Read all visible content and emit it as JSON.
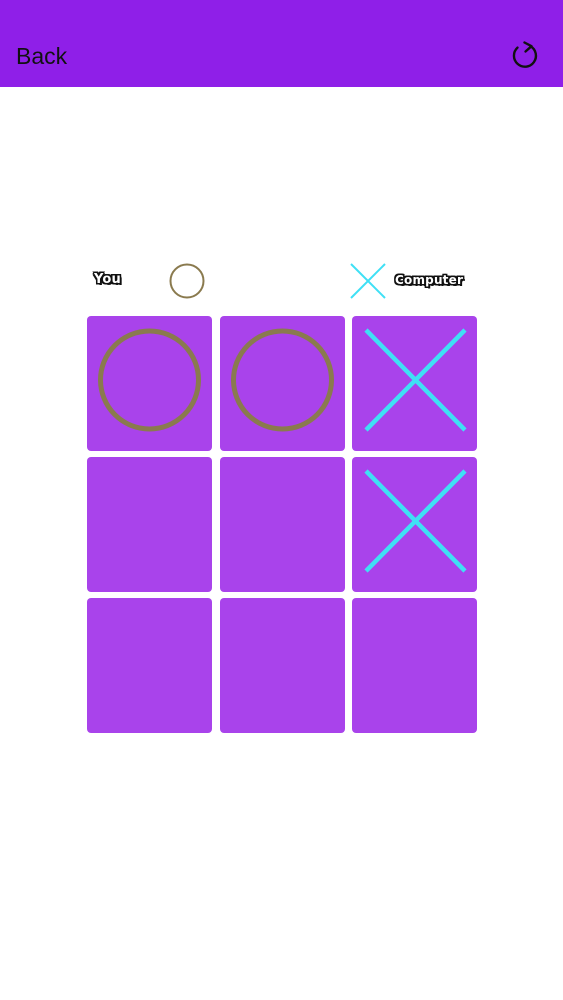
{
  "header": {
    "back_label": "Back",
    "restart_icon": "restart-icon"
  },
  "players": {
    "you": {
      "label": "You",
      "mark": "O"
    },
    "computer": {
      "label": "Computer",
      "mark": "X"
    }
  },
  "board": {
    "cells": [
      [
        "O",
        "O",
        "X"
      ],
      [
        "",
        "",
        "X"
      ],
      [
        "",
        "",
        ""
      ]
    ]
  },
  "colors": {
    "header": "#8f1fe8",
    "cell": "#a943eb",
    "o_mark": "#8a7a4e",
    "x_mark": "#3fe0f5"
  }
}
